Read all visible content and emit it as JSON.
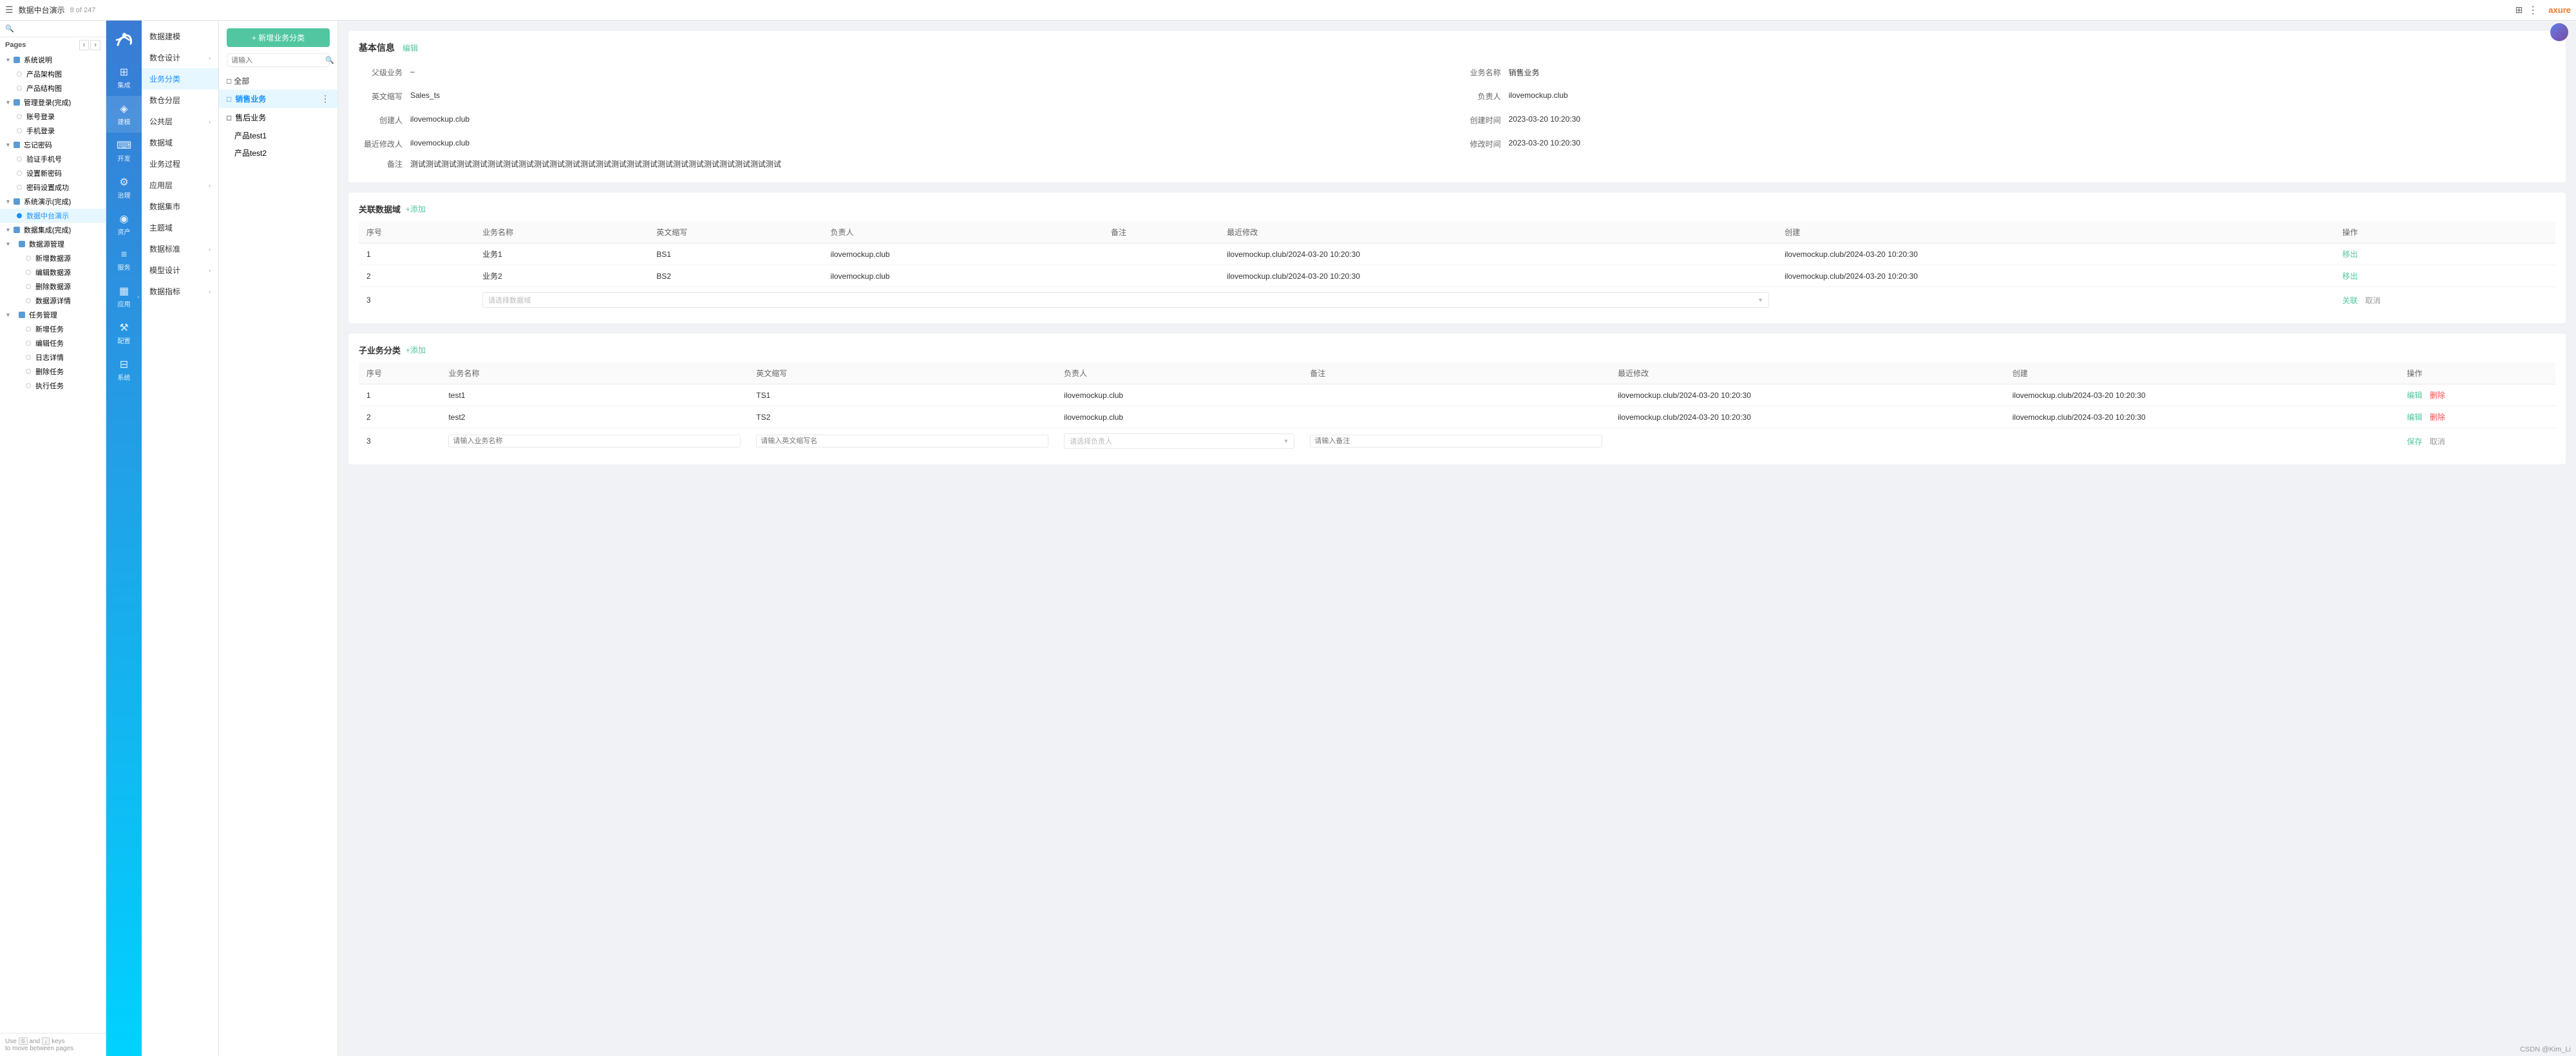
{
  "topbar": {
    "menu_icon": "☰",
    "title": "数据中台演示",
    "page_count": "8 of 247",
    "grid_icon": "⊞",
    "more_icon": "⋮",
    "brand": "axure"
  },
  "sidebar": {
    "pages_label": "Pages",
    "nav_prev": "‹",
    "nav_next": "›",
    "tree": [
      {
        "level": 0,
        "label": "系统说明",
        "type": "group",
        "expanded": true
      },
      {
        "level": 1,
        "label": "产品架构图",
        "type": "leaf"
      },
      {
        "level": 1,
        "label": "产品结构图",
        "type": "leaf"
      },
      {
        "level": 0,
        "label": "管理登录(完成)",
        "type": "group",
        "expanded": true
      },
      {
        "level": 1,
        "label": "账号登录",
        "type": "leaf"
      },
      {
        "level": 1,
        "label": "手机登录",
        "type": "leaf"
      },
      {
        "level": 0,
        "label": "忘记密码",
        "type": "group",
        "expanded": true
      },
      {
        "level": 1,
        "label": "验证手机号",
        "type": "leaf"
      },
      {
        "level": 1,
        "label": "设置新密码",
        "type": "leaf"
      },
      {
        "level": 1,
        "label": "密码设置成功",
        "type": "leaf"
      },
      {
        "level": 0,
        "label": "系统演示(完成)",
        "type": "group",
        "expanded": true
      },
      {
        "level": 1,
        "label": "数据中台演示",
        "type": "leaf",
        "active": true
      },
      {
        "level": 0,
        "label": "数据集成(完成)",
        "type": "group",
        "expanded": true
      },
      {
        "level": 0,
        "label": "数据源管理",
        "type": "group",
        "expanded": true
      },
      {
        "level": 1,
        "label": "新增数据源",
        "type": "leaf"
      },
      {
        "level": 1,
        "label": "编辑数据源",
        "type": "leaf"
      },
      {
        "level": 1,
        "label": "删除数据源",
        "type": "leaf"
      },
      {
        "level": 1,
        "label": "数据源详情",
        "type": "leaf"
      },
      {
        "level": 0,
        "label": "任务管理",
        "type": "group",
        "expanded": true
      },
      {
        "level": 1,
        "label": "新增任务",
        "type": "leaf"
      },
      {
        "level": 1,
        "label": "编辑任务",
        "type": "leaf"
      },
      {
        "level": 1,
        "label": "日志详情",
        "type": "leaf"
      },
      {
        "level": 1,
        "label": "删除任务",
        "type": "leaf"
      },
      {
        "level": 1,
        "label": "执行任务",
        "type": "leaf"
      }
    ],
    "bottom_hint": "Use",
    "bottom_key1": "S",
    "bottom_and": "and",
    "bottom_key2": "↓",
    "bottom_keys": "keys",
    "bottom_hint2": "to move between pages"
  },
  "nav_menu": {
    "items": [
      {
        "label": "集成",
        "icon": "⊞",
        "has_arrow": false
      },
      {
        "label": "建模",
        "icon": "◈",
        "has_arrow": false,
        "active": true
      },
      {
        "label": "开发",
        "icon": "⌨",
        "has_arrow": false
      },
      {
        "label": "治理",
        "icon": "⚙",
        "has_arrow": false
      },
      {
        "label": "资产",
        "icon": "◉",
        "has_arrow": false
      },
      {
        "label": "服务",
        "icon": "≡",
        "has_arrow": false
      },
      {
        "label": "应用",
        "icon": "▦",
        "has_arrow": true
      },
      {
        "label": "配置",
        "icon": "⚒",
        "has_arrow": false,
        "active2": true
      },
      {
        "label": "系统",
        "icon": "⊟",
        "has_arrow": false
      }
    ]
  },
  "sub_nav": {
    "items": [
      {
        "label": "数据建模",
        "has_arrow": false
      },
      {
        "label": "数仓设计",
        "has_arrow": true
      },
      {
        "label": "业务分类",
        "active": true,
        "has_arrow": false
      },
      {
        "label": "数仓分层",
        "has_arrow": false
      },
      {
        "label": "公共层",
        "has_arrow": true
      },
      {
        "label": "数据域",
        "has_arrow": false
      },
      {
        "label": "业务过程",
        "has_arrow": false
      },
      {
        "label": "应用层",
        "has_arrow": true
      },
      {
        "label": "数据集市",
        "has_arrow": false
      },
      {
        "label": "主题域",
        "has_arrow": false
      },
      {
        "label": "数据标准",
        "has_arrow": true
      },
      {
        "label": "模型设计",
        "has_arrow": true
      },
      {
        "label": "数据指标",
        "has_arrow": true
      }
    ]
  },
  "biz_tree": {
    "add_button": "+ 新增业务分类",
    "search_placeholder": "请输入",
    "all_label": "□ 全部",
    "nodes": [
      {
        "label": "□ 销售业务",
        "active": true,
        "has_more": true,
        "level": 0
      },
      {
        "label": "□ 售后业务",
        "active": false,
        "has_more": false,
        "level": 0
      },
      {
        "label": "产品test1",
        "level": 1
      },
      {
        "label": "产品test2",
        "level": 1
      }
    ]
  },
  "detail": {
    "basic_info_title": "基本信息",
    "edit_label": "编辑",
    "fields": {
      "parent_biz_label": "父级业务",
      "parent_biz_value": "–",
      "biz_name_label": "业务名称",
      "biz_name_value": "销售业务",
      "en_abbr_label": "英文缩写",
      "en_abbr_value": "Sales_ts",
      "owner_label": "负责人",
      "owner_value": "ilovemockup.club",
      "creator_label": "创建人",
      "creator_value": "ilovemockup.club",
      "create_time_label": "创建时间",
      "create_time_value": "2023-03-20 10:20:30",
      "last_modifier_label": "最近修改人",
      "last_modifier_value": "ilovemockup.club",
      "modify_time_label": "修改时间",
      "modify_time_value": "2023-03-20 10:20:30",
      "remark_label": "备注",
      "remark_value": "测试测试测试测试测试测试测试测试测试测试测试测试测试测试测试测试测试测试测试测试测试测试测试测试"
    },
    "related_domain": {
      "title": "关联数据域",
      "add_label": "+添加",
      "columns": [
        "序号",
        "业务名称",
        "英文缩写",
        "负责人",
        "备注",
        "最近修改",
        "创建",
        "操作"
      ],
      "rows": [
        {
          "seq": "1",
          "biz_name": "业务1",
          "en_abbr": "BS1",
          "owner": "ilovemockup.club",
          "remark": "",
          "last_modify": "ilovemockup.club/2024-03-20 10:20:30",
          "create": "ilovemockup.club/2024-03-20 10:20:30",
          "action": "移出"
        },
        {
          "seq": "2",
          "biz_name": "业务2",
          "en_abbr": "BS2",
          "owner": "ilovemockup.club",
          "remark": "",
          "last_modify": "ilovemockup.club/2024-03-20 10:20:30",
          "create": "ilovemockup.club/2024-03-20 10:20:30",
          "action": "移出"
        },
        {
          "seq": "3",
          "biz_name": "",
          "en_abbr": "",
          "owner": "",
          "remark": "",
          "last_modify": "",
          "create": "",
          "action1": "关联",
          "action2": "取消",
          "is_input": true,
          "placeholder": "请选择数据域"
        }
      ]
    },
    "sub_biz": {
      "title": "子业务分类",
      "add_label": "+添加",
      "columns": [
        "序号",
        "业务名称",
        "英文缩写",
        "负责人",
        "备注",
        "最近修改",
        "创建",
        "操作"
      ],
      "rows": [
        {
          "seq": "1",
          "biz_name": "test1",
          "en_abbr": "TS1",
          "owner": "ilovemockup.club",
          "remark": "",
          "last_modify": "ilovemockup.club/2024-03-20 10:20:30",
          "create": "ilovemockup.club/2024-03-20 10:20:30",
          "action1": "编辑",
          "action2": "删除"
        },
        {
          "seq": "2",
          "biz_name": "test2",
          "en_abbr": "TS2",
          "owner": "ilovemockup.club",
          "remark": "",
          "last_modify": "ilovemockup.club/2024-03-20 10:20:30",
          "create": "ilovemockup.club/2024-03-20 10:20:30",
          "action1": "编辑",
          "action2": "删除"
        },
        {
          "seq": "3",
          "biz_name": "",
          "en_abbr": "",
          "owner": "",
          "remark": "",
          "is_input": true,
          "placeholder_name": "请输入业务名称",
          "placeholder_en": "请输入英文缩写名",
          "placeholder_owner": "请选择负责人",
          "placeholder_remark": "请输入备注",
          "action1": "保存",
          "action2": "取消"
        }
      ]
    }
  },
  "watermark": "CSDN @Kim_Li",
  "keyboard_hint": {
    "use": "Use",
    "and": "and",
    "keys": "keys",
    "to_move": "to move between pages",
    "key_s": "S",
    "key_arrow": "↓"
  }
}
